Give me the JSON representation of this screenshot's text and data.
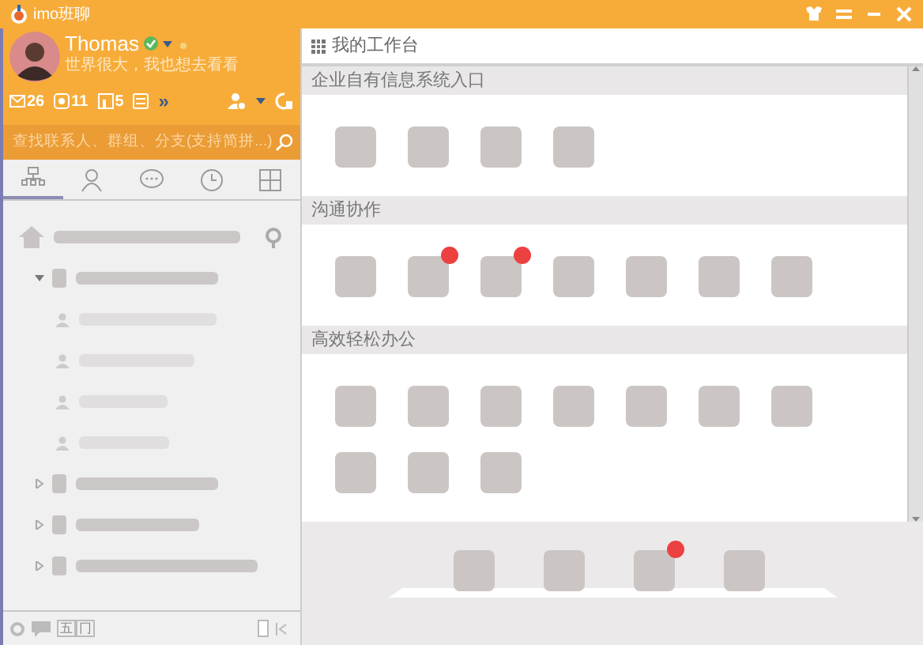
{
  "window": {
    "title": "imo班聊"
  },
  "profile": {
    "name": "Thomas",
    "verified": true,
    "signature": "世界很大，我也想去看看"
  },
  "counters": [
    {
      "kind": "mail",
      "count": "26"
    },
    {
      "kind": "notice",
      "count": "11"
    },
    {
      "kind": "report",
      "count": "5"
    },
    {
      "kind": "memo"
    }
  ],
  "more": "»",
  "search": {
    "placeholder": "查找联系人、群组、分支(支持简拼...)"
  },
  "tabs": [
    {
      "kind": "org",
      "selected": true
    },
    {
      "kind": "contact",
      "selected": false
    },
    {
      "kind": "chat",
      "selected": false
    },
    {
      "kind": "recent",
      "selected": false
    },
    {
      "kind": "apps",
      "selected": false
    }
  ],
  "tree": [
    {
      "kind": "home",
      "children": [
        {
          "kind": "group",
          "expanded": true,
          "children": [
            {
              "kind": "person"
            },
            {
              "kind": "person"
            },
            {
              "kind": "person"
            },
            {
              "kind": "person"
            }
          ]
        },
        {
          "kind": "group",
          "expanded": false
        },
        {
          "kind": "group",
          "expanded": false
        },
        {
          "kind": "group",
          "expanded": false
        }
      ]
    }
  ],
  "footer": {
    "keys": [
      "五",
      "冂"
    ]
  },
  "workspace": {
    "title": "我的工作台",
    "sections": [
      {
        "title": "企业自有信息系统入口",
        "apps": [
          {
            "badge": false
          },
          {
            "badge": false
          },
          {
            "badge": false
          },
          {
            "badge": false
          }
        ]
      },
      {
        "title": "沟通协作",
        "apps": [
          {
            "badge": false
          },
          {
            "badge": true
          },
          {
            "badge": true
          },
          {
            "badge": false
          },
          {
            "badge": false
          },
          {
            "badge": false
          },
          {
            "badge": false
          }
        ]
      },
      {
        "title": "高效轻松办公",
        "apps": [
          {
            "badge": false
          },
          {
            "badge": false
          },
          {
            "badge": false
          },
          {
            "badge": false
          },
          {
            "badge": false
          },
          {
            "badge": false
          },
          {
            "badge": false
          },
          {
            "badge": false
          },
          {
            "badge": false
          },
          {
            "badge": false
          }
        ]
      }
    ],
    "dock": [
      {
        "badge": false
      },
      {
        "badge": false
      },
      {
        "badge": true
      },
      {
        "badge": false
      }
    ]
  }
}
